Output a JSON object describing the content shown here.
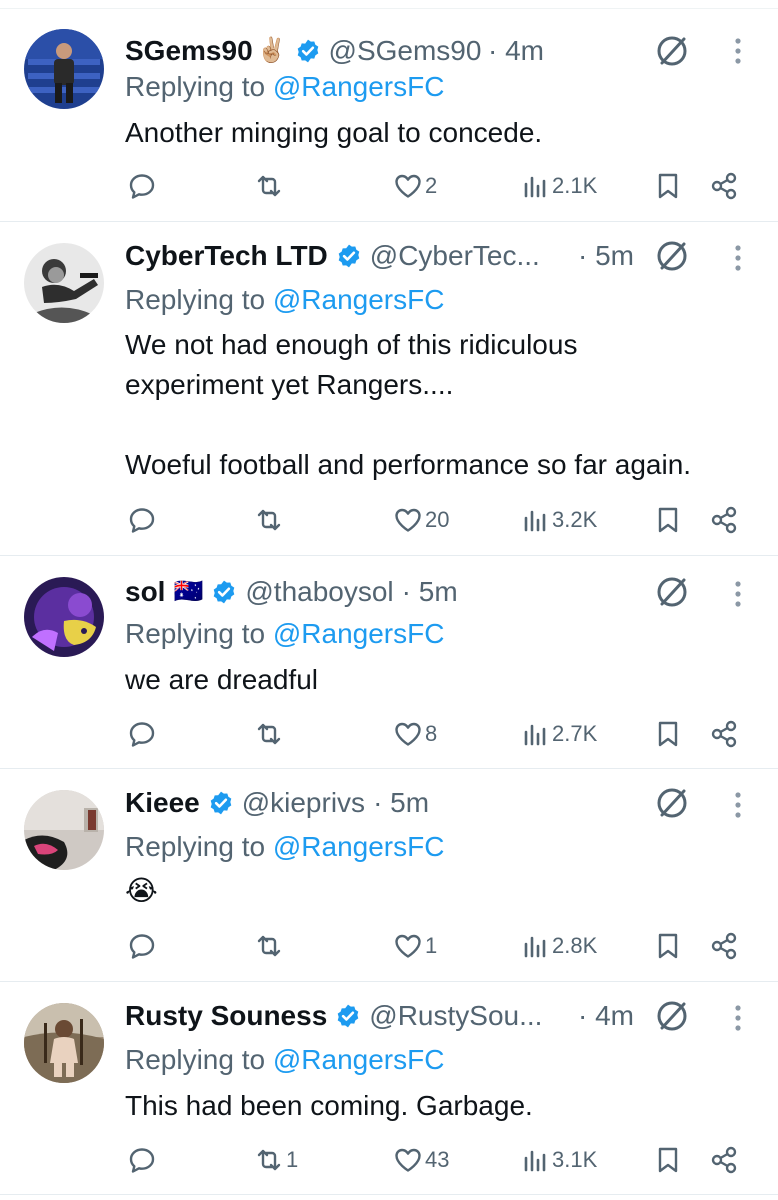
{
  "reply_prefix": "Replying to ",
  "colors": {
    "text": "#0f1419",
    "secondary": "#536471",
    "accent": "#1d9bf0",
    "divider": "#e6ecf0"
  },
  "icons": [
    "reply-icon",
    "retweet-icon",
    "like-icon",
    "views-icon",
    "bookmark-icon",
    "share-icon",
    "grok-icon",
    "more-icon",
    "verified-badge-icon"
  ],
  "tweets": [
    {
      "display_name": "SGems90",
      "name_emoji": "✌🏼",
      "handle": "@SGems90",
      "time": "· 4m",
      "reply_to": "@RangersFC",
      "text": "Another minging goal to concede.",
      "replies": "",
      "retweets": "",
      "likes": "2",
      "views": "2.1K"
    },
    {
      "display_name": "CyberTech LTD",
      "name_emoji": "",
      "handle": "@CyberTec...",
      "time": "· 5m",
      "reply_to": "@RangersFC",
      "text": "We not had enough of this ridiculous\nexperiment yet Rangers....\n\nWoeful football and performance so far again.",
      "replies": "",
      "retweets": "",
      "likes": "20",
      "views": "3.2K"
    },
    {
      "display_name": "sol",
      "name_emoji": "🇦🇺",
      "handle": "@thaboysol",
      "time": "· 5m",
      "reply_to": "@RangersFC",
      "text": "we are dreadful",
      "replies": "",
      "retweets": "",
      "likes": "8",
      "views": "2.7K"
    },
    {
      "display_name": "Kieee",
      "name_emoji": "",
      "handle": "@kieprivs",
      "time": "· 5m",
      "reply_to": "@RangersFC",
      "text": "😭",
      "replies": "",
      "retweets": "",
      "likes": "1",
      "views": "2.8K"
    },
    {
      "display_name": "Rusty Souness",
      "name_emoji": "",
      "handle": "@RustySou...",
      "time": "· 4m",
      "reply_to": "@RangersFC",
      "text": "This had been coming. Garbage.",
      "replies": "",
      "retweets": "1",
      "likes": "43",
      "views": "3.1K"
    }
  ]
}
